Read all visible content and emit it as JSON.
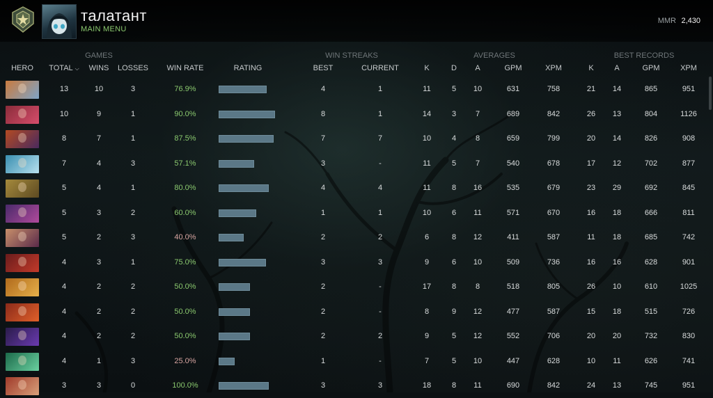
{
  "player": {
    "name": "талатант",
    "menu_label": "MAIN MENU"
  },
  "mmr": {
    "label": "MMR",
    "value": "2,430"
  },
  "groups": {
    "games": "GAMES",
    "win_streaks": "WIN STREAKS",
    "averages": "AVERAGES",
    "best_records": "BEST RECORDS"
  },
  "columns": {
    "hero": "HERO",
    "total": "TOTAL",
    "wins": "WINS",
    "losses": "LOSSES",
    "win_rate": "WIN RATE",
    "rating": "RATING",
    "best": "BEST",
    "current": "CURRENT",
    "k": "K",
    "d": "D",
    "a": "A",
    "gpm": "GPM",
    "xpm": "XPM",
    "rk": "K",
    "ra": "A",
    "rgpm": "GPM",
    "rxpm": "XPM"
  },
  "heroes": [
    {
      "portrait_colors": [
        "#c97b3f",
        "#7fa4c6"
      ],
      "total": "13",
      "wins": "10",
      "losses": "3",
      "win_rate": "76.9%",
      "rating": 0.769,
      "best": "4",
      "current": "1",
      "k": "11",
      "d": "5",
      "a": "10",
      "gpm": "631",
      "xpm": "758",
      "rk": "21",
      "ra": "14",
      "rgpm": "865",
      "rxpm": "951"
    },
    {
      "portrait_colors": [
        "#8a2c3a",
        "#d64d6b"
      ],
      "total": "10",
      "wins": "9",
      "losses": "1",
      "win_rate": "90.0%",
      "rating": 0.9,
      "best": "8",
      "current": "1",
      "k": "14",
      "d": "3",
      "a": "7",
      "gpm": "689",
      "xpm": "842",
      "rk": "26",
      "ra": "13",
      "rgpm": "804",
      "rxpm": "1126"
    },
    {
      "portrait_colors": [
        "#b34a22",
        "#4a2a5e"
      ],
      "total": "8",
      "wins": "7",
      "losses": "1",
      "win_rate": "87.5%",
      "rating": 0.875,
      "best": "7",
      "current": "7",
      "k": "10",
      "d": "4",
      "a": "8",
      "gpm": "659",
      "xpm": "799",
      "rk": "20",
      "ra": "14",
      "rgpm": "826",
      "rxpm": "908"
    },
    {
      "portrait_colors": [
        "#3a8fb0",
        "#b7e0ee"
      ],
      "total": "7",
      "wins": "4",
      "losses": "3",
      "win_rate": "57.1%",
      "rating": 0.571,
      "best": "3",
      "current": "-",
      "k": "11",
      "d": "5",
      "a": "7",
      "gpm": "540",
      "xpm": "678",
      "rk": "17",
      "ra": "12",
      "rgpm": "702",
      "rxpm": "877"
    },
    {
      "portrait_colors": [
        "#a58a3c",
        "#5d4a22"
      ],
      "total": "5",
      "wins": "4",
      "losses": "1",
      "win_rate": "80.0%",
      "rating": 0.8,
      "best": "4",
      "current": "4",
      "k": "11",
      "d": "8",
      "a": "16",
      "gpm": "535",
      "xpm": "679",
      "rk": "23",
      "ra": "29",
      "rgpm": "692",
      "rxpm": "845"
    },
    {
      "portrait_colors": [
        "#4a2a6a",
        "#b04a9c"
      ],
      "total": "5",
      "wins": "3",
      "losses": "2",
      "win_rate": "60.0%",
      "rating": 0.6,
      "best": "1",
      "current": "1",
      "k": "10",
      "d": "6",
      "a": "11",
      "gpm": "571",
      "xpm": "670",
      "rk": "16",
      "ra": "18",
      "rgpm": "666",
      "rxpm": "811"
    },
    {
      "portrait_colors": [
        "#c88f6a",
        "#5a2a4a"
      ],
      "total": "5",
      "wins": "2",
      "losses": "3",
      "win_rate": "40.0%",
      "rating": 0.4,
      "best": "2",
      "current": "2",
      "k": "6",
      "d": "8",
      "a": "12",
      "gpm": "411",
      "xpm": "587",
      "rk": "11",
      "ra": "18",
      "rgpm": "685",
      "rxpm": "742"
    },
    {
      "portrait_colors": [
        "#6a1c1c",
        "#c23a2a"
      ],
      "total": "4",
      "wins": "3",
      "losses": "1",
      "win_rate": "75.0%",
      "rating": 0.75,
      "best": "3",
      "current": "3",
      "k": "9",
      "d": "6",
      "a": "10",
      "gpm": "509",
      "xpm": "736",
      "rk": "16",
      "ra": "16",
      "rgpm": "628",
      "rxpm": "901"
    },
    {
      "portrait_colors": [
        "#b06a1c",
        "#e6b04a"
      ],
      "total": "4",
      "wins": "2",
      "losses": "2",
      "win_rate": "50.0%",
      "rating": 0.5,
      "best": "2",
      "current": "-",
      "k": "17",
      "d": "8",
      "a": "8",
      "gpm": "518",
      "xpm": "805",
      "rk": "26",
      "ra": "10",
      "rgpm": "610",
      "rxpm": "1025"
    },
    {
      "portrait_colors": [
        "#8a2a1a",
        "#e0602a"
      ],
      "total": "4",
      "wins": "2",
      "losses": "2",
      "win_rate": "50.0%",
      "rating": 0.5,
      "best": "2",
      "current": "-",
      "k": "8",
      "d": "9",
      "a": "12",
      "gpm": "477",
      "xpm": "587",
      "rk": "15",
      "ra": "18",
      "rgpm": "515",
      "rxpm": "726"
    },
    {
      "portrait_colors": [
        "#2a1c4a",
        "#6a3ab0"
      ],
      "total": "4",
      "wins": "2",
      "losses": "2",
      "win_rate": "50.0%",
      "rating": 0.5,
      "best": "2",
      "current": "2",
      "k": "9",
      "d": "5",
      "a": "12",
      "gpm": "552",
      "xpm": "706",
      "rk": "20",
      "ra": "20",
      "rgpm": "732",
      "rxpm": "830"
    },
    {
      "portrait_colors": [
        "#1c6a4a",
        "#6ad0a0"
      ],
      "total": "4",
      "wins": "1",
      "losses": "3",
      "win_rate": "25.0%",
      "rating": 0.25,
      "best": "1",
      "current": "-",
      "k": "7",
      "d": "5",
      "a": "10",
      "gpm": "447",
      "xpm": "628",
      "rk": "10",
      "ra": "11",
      "rgpm": "626",
      "rxpm": "741"
    },
    {
      "portrait_colors": [
        "#a03a2a",
        "#d8a07a"
      ],
      "total": "3",
      "wins": "3",
      "losses": "0",
      "win_rate": "100.0%",
      "rating": 0.8,
      "best": "3",
      "current": "3",
      "k": "18",
      "d": "8",
      "a": "11",
      "gpm": "690",
      "xpm": "842",
      "rk": "24",
      "ra": "13",
      "rgpm": "745",
      "rxpm": "951"
    }
  ]
}
